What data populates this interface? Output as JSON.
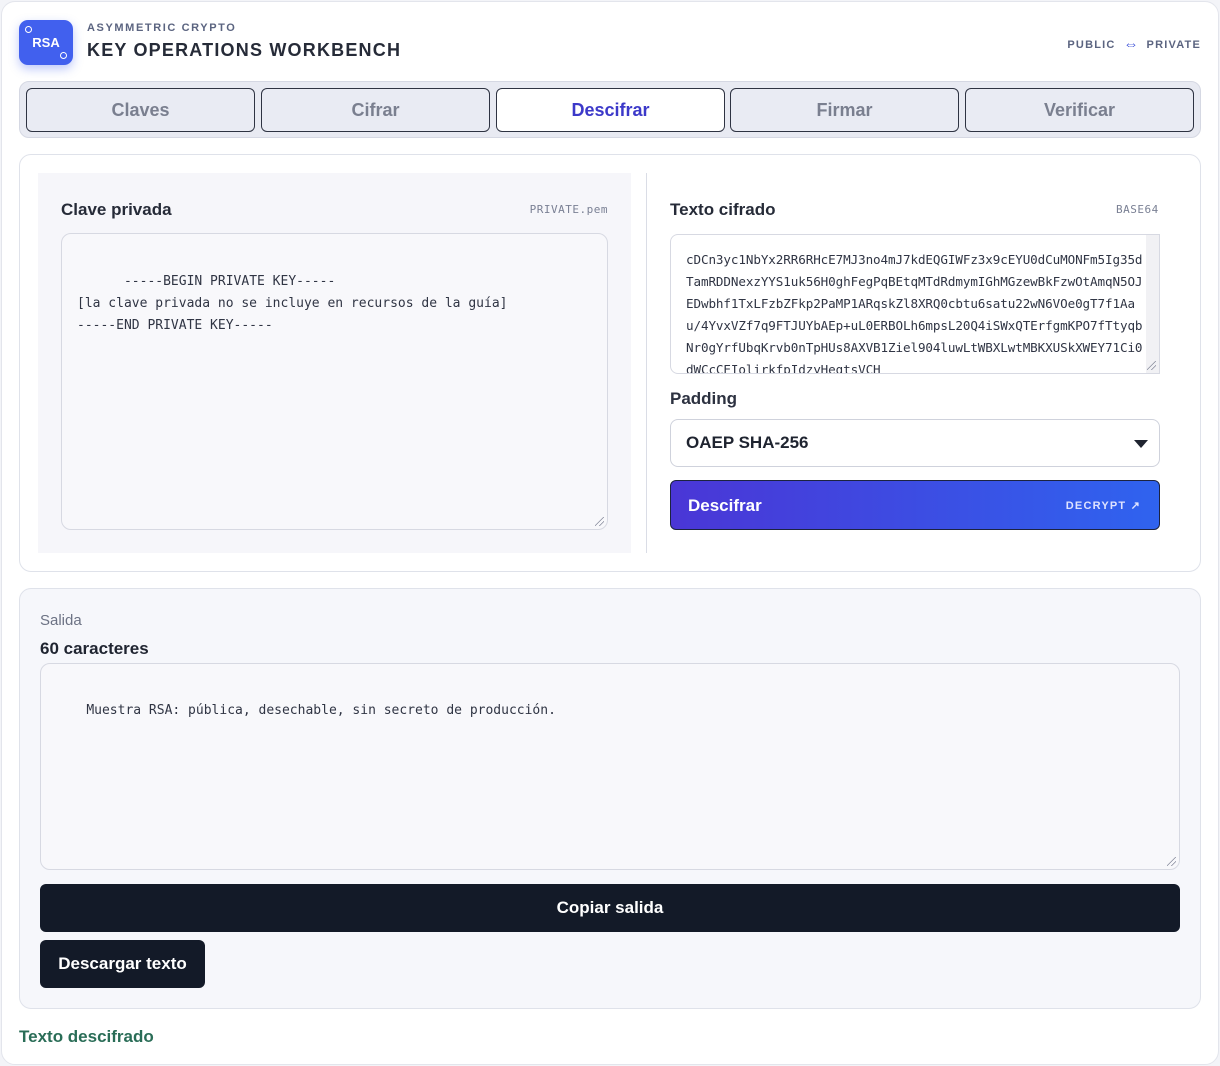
{
  "header": {
    "logo_text": "RSA",
    "eyebrow": "ASYMMETRIC CRYPTO",
    "title": "KEY OPERATIONS WORKBENCH",
    "pair_left": "PUBLIC",
    "pair_arrows": "⇔",
    "pair_right": "PRIVATE"
  },
  "tabs": [
    {
      "label": "Claves",
      "active": false
    },
    {
      "label": "Cifrar",
      "active": false
    },
    {
      "label": "Descifrar",
      "active": true
    },
    {
      "label": "Firmar",
      "active": false
    },
    {
      "label": "Verificar",
      "active": false
    }
  ],
  "private_key": {
    "title": "Clave privada",
    "tag": "PRIVATE.pem",
    "value": "-----BEGIN PRIVATE KEY-----\n[la clave privada no se incluye en recursos de la guía]\n-----END PRIVATE KEY-----"
  },
  "ciphertext": {
    "title": "Texto cifrado",
    "tag": "BASE64",
    "value": "cDCn3yc1NbYx2RR6RHcE7MJ3no4mJ7kdEQGIWFz3x9cEYU0dCuMONFm5Ig35dTamRDDNexzYYS1uk56H0ghFegPqBEtqMTdRdmymIGhMGzewBkFzwOtAmqN5OJEDwbhf1TxLFzbZFkp2PaMP1ARqskZl8XRQ0cbtu6satu22wN6VOe0gT7f1Aau/4YvxVZf7q9FTJUYbAEp+uL0ERBOLh6mpsL20Q4iSWxQTErfgmKPO7fTtyqbNr0gYrfUbqKrvb0nTpHUs8AXVB1Ziel904luwLtWBXLwtMBKXUSkXWEY71Ci0dWCcCEIolirkfpIdzyHegtsVCH"
  },
  "padding": {
    "label": "Padding",
    "selected": "OAEP SHA-256"
  },
  "decrypt_button": {
    "label": "Descifrar",
    "hint": "DECRYPT ↗"
  },
  "output": {
    "eyebrow": "Salida",
    "count": "60 caracteres",
    "value": "Muestra RSA: pública, desechable, sin secreto de producción.",
    "copy_label": "Copiar salida",
    "download_label": "Descargar texto"
  },
  "status": "Texto descifrado",
  "colors": {
    "accent": "#3c39c9",
    "brand": "#4160ee",
    "dark_button": "#131a28",
    "status": "#2a6d57"
  }
}
